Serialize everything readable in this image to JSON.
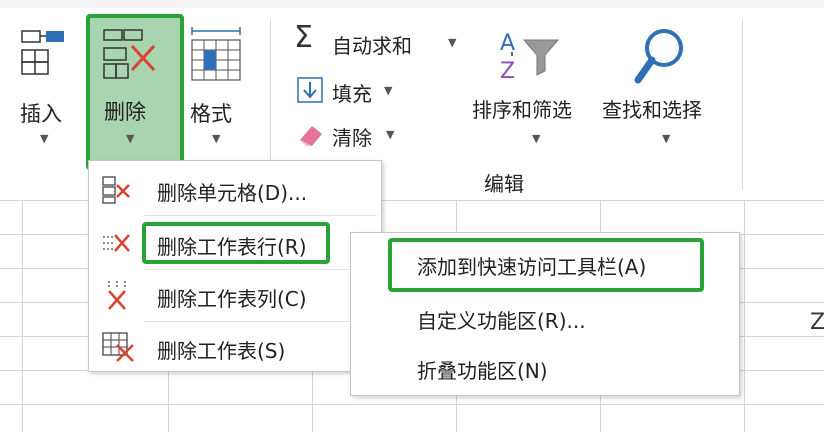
{
  "ribbon": {
    "cells_group": {
      "insert_label": "插入",
      "delete_label": "删除",
      "format_label": "格式"
    },
    "editing_group": {
      "autosum_label": "自动求和",
      "fill_label": "填充",
      "clear_label": "清除",
      "sort_filter_label": "排序和筛选",
      "find_select_label": "查找和选择",
      "group_label": "编辑"
    }
  },
  "delete_menu": {
    "items": [
      {
        "label": "删除单元格(D)...",
        "icon": "delete-cells-icon"
      },
      {
        "label": "删除工作表行(R)",
        "icon": "delete-sheet-rows-icon"
      },
      {
        "label": "删除工作表列(C)",
        "icon": "delete-sheet-columns-icon"
      },
      {
        "label": "删除工作表(S)",
        "icon": "delete-sheet-icon"
      }
    ]
  },
  "context_menu": {
    "items": [
      {
        "label": "添加到快速访问工具栏(A)"
      },
      {
        "label": "自定义功能区(R)..."
      },
      {
        "label": "折叠功能区(N)"
      }
    ]
  },
  "sheet": {
    "partial_text": "Z"
  },
  "colors": {
    "highlight": "#2aa23a",
    "selected_button": "#a8d5b0",
    "delete_red": "#d9432f",
    "icon_blue": "#2f6fb6"
  }
}
